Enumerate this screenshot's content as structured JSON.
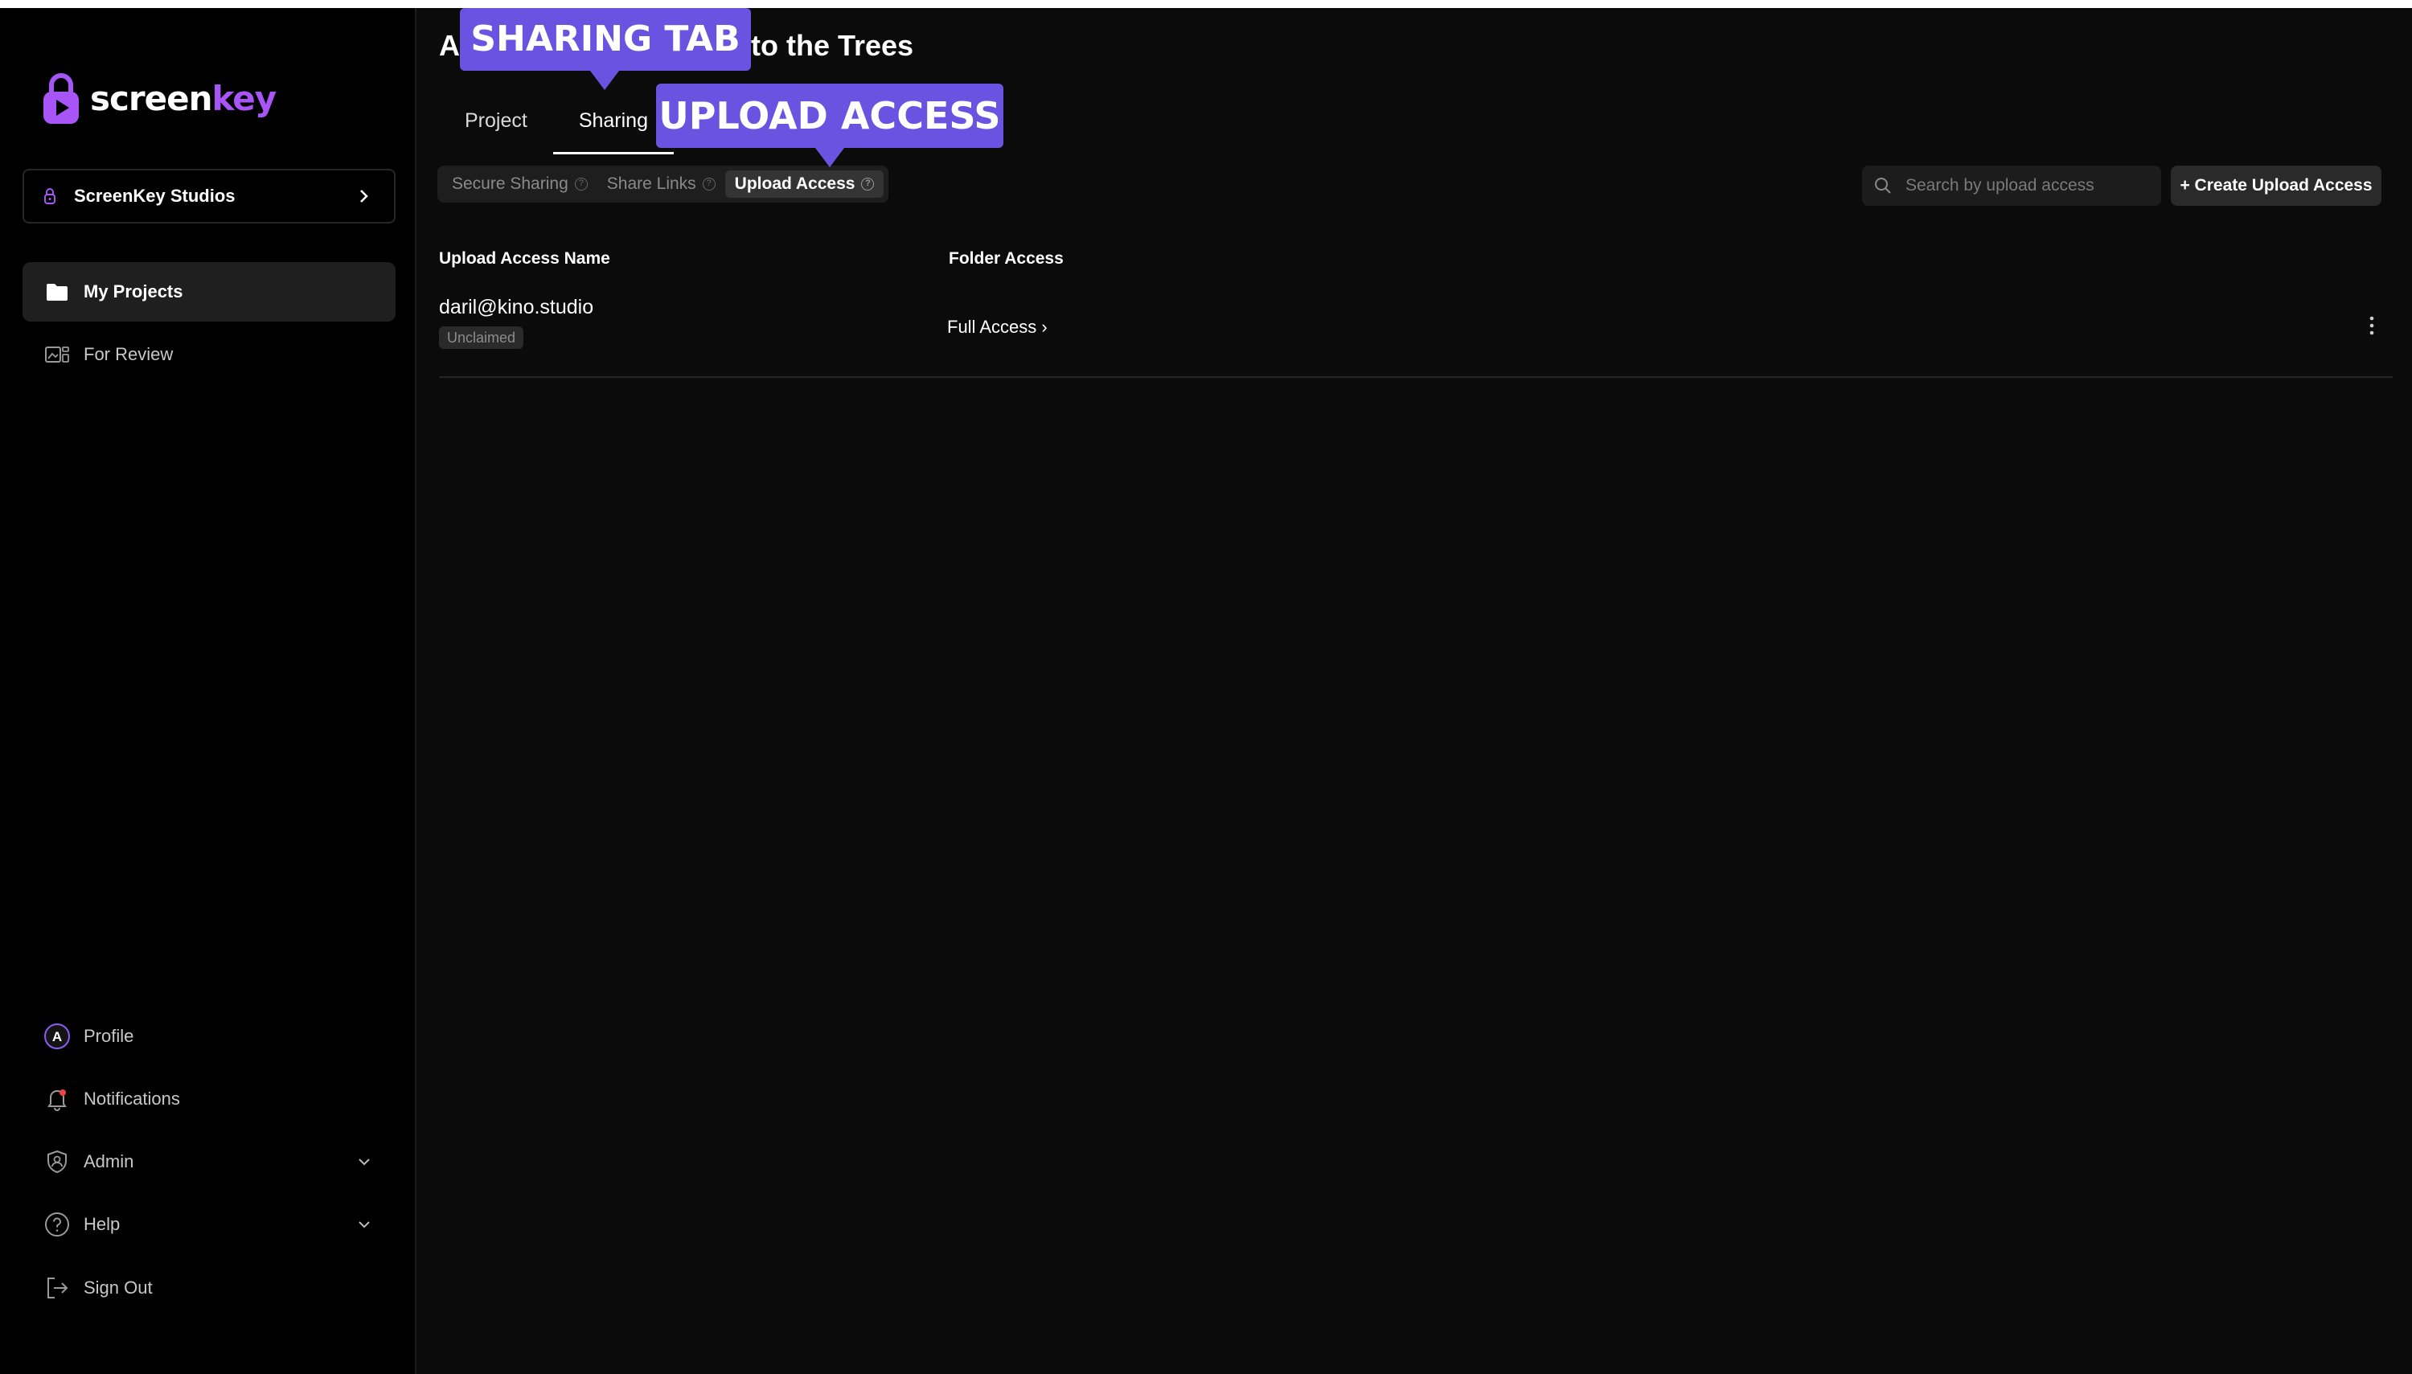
{
  "app": {
    "logo_text_white": "screen",
    "logo_text_accent": "key",
    "brand_color": "#a855f7",
    "callout_color": "#6a53e0"
  },
  "sidebar": {
    "workspace": {
      "label": "ScreenKey Studios",
      "icon": "lock-icon"
    },
    "nav_top": [
      {
        "label": "My Projects",
        "icon": "folder-icon",
        "active": true
      },
      {
        "label": "For Review",
        "icon": "review-icon",
        "active": false
      }
    ],
    "nav_bottom": [
      {
        "label": "Profile",
        "icon": "avatar-icon",
        "avatar_letter": "A"
      },
      {
        "label": "Notifications",
        "icon": "bell-icon"
      },
      {
        "label": "Admin",
        "icon": "shield-icon",
        "expandable": true
      },
      {
        "label": "Help",
        "icon": "help-icon",
        "expandable": true
      },
      {
        "label": "Sign Out",
        "icon": "sign-out-icon"
      }
    ]
  },
  "main": {
    "title_left": "A",
    "title_right": "to the Trees",
    "tabs": [
      {
        "label": "Project",
        "active": false
      },
      {
        "label": "Sharing",
        "active": true
      }
    ],
    "sub_tabs": [
      {
        "label": "Secure Sharing",
        "active": false
      },
      {
        "label": "Share Links",
        "active": false
      },
      {
        "label": "Upload Access",
        "active": true
      }
    ],
    "search": {
      "placeholder": "Search by upload access",
      "value": ""
    },
    "create_button": "+ Create Upload Access",
    "table": {
      "columns": [
        "Upload Access Name",
        "Folder Access"
      ],
      "rows": [
        {
          "name": "daril@kino.studio",
          "status": "Unclaimed",
          "folder_access": "Full Access ›"
        }
      ]
    }
  },
  "callouts": {
    "sharing": "SHARING TAB",
    "upload": "UPLOAD ACCESS"
  }
}
